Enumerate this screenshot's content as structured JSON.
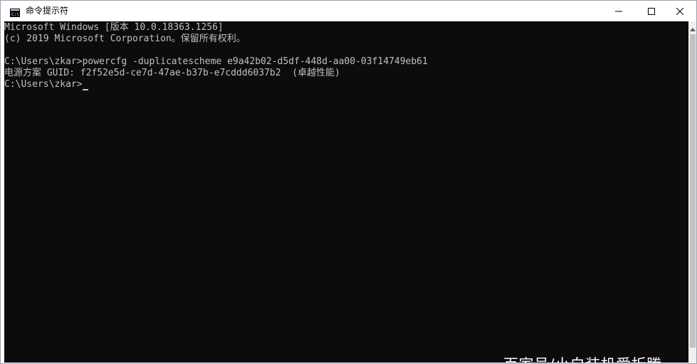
{
  "window": {
    "title": "命令提示符",
    "icon": "cmd-icon",
    "controls": {
      "minimize": "minimize-icon",
      "maximize": "maximize-icon",
      "close": "close-icon"
    }
  },
  "console": {
    "lines": [
      "Microsoft Windows [版本 10.0.18363.1256]",
      "(c) 2019 Microsoft Corporation。保留所有权利。",
      "",
      "C:\\Users\\zkar>powercfg -duplicatescheme e9a42b02-d5df-448d-aa00-03f14749eb61",
      "电源方案 GUID: f2f52e5d-ce7d-47ae-b37b-e7cddd6037b2  (卓越性能)",
      "C:\\Users\\zkar>"
    ],
    "background": "#0c0c0c",
    "foreground": "#c0c0c0"
  },
  "watermark": "百家号/小白装机爱折腾"
}
